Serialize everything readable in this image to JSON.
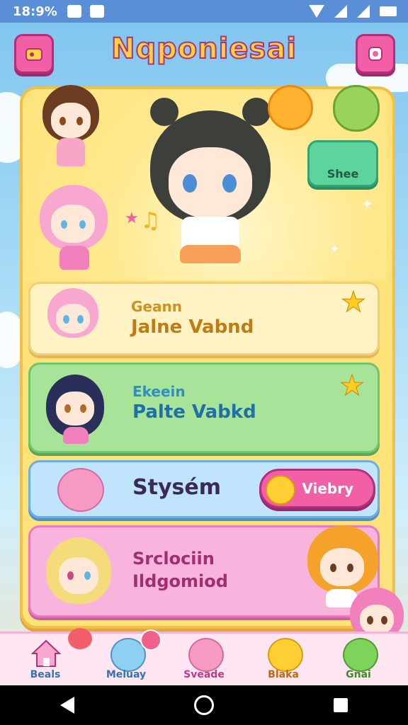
{
  "status_bar": {
    "time": "18:9%"
  },
  "header": {
    "title": "Nqponiesai"
  },
  "hero": {
    "side_button_label": "Shee"
  },
  "cards": [
    {
      "line1": "Geann",
      "line2": "Jalne Vabnd",
      "color": "#fff3c6"
    },
    {
      "line1": "Ekeein",
      "line2": "Palte Vabkd",
      "color": "#a8e39a"
    },
    {
      "title": "Stysém",
      "button_label": "Viebry",
      "color": "#bfe4fb"
    },
    {
      "line1": "Srclociin",
      "line2": "Ildgomiod",
      "color": "#f9b4de"
    }
  ],
  "bottom_nav": [
    {
      "label": "Beals",
      "icon": "house-icon"
    },
    {
      "label": "Meluay",
      "icon": "slime-blue-icon"
    },
    {
      "label": "Sveade",
      "icon": "slime-pink-icon"
    },
    {
      "label": "Blaka",
      "icon": "slime-yellow-icon"
    },
    {
      "label": "Gnai",
      "icon": "slime-green-icon"
    }
  ],
  "colors": {
    "accent_pink": "#f25fa7",
    "panel_yellow": "#ffe27a",
    "title_yellow": "#ffd23f"
  }
}
